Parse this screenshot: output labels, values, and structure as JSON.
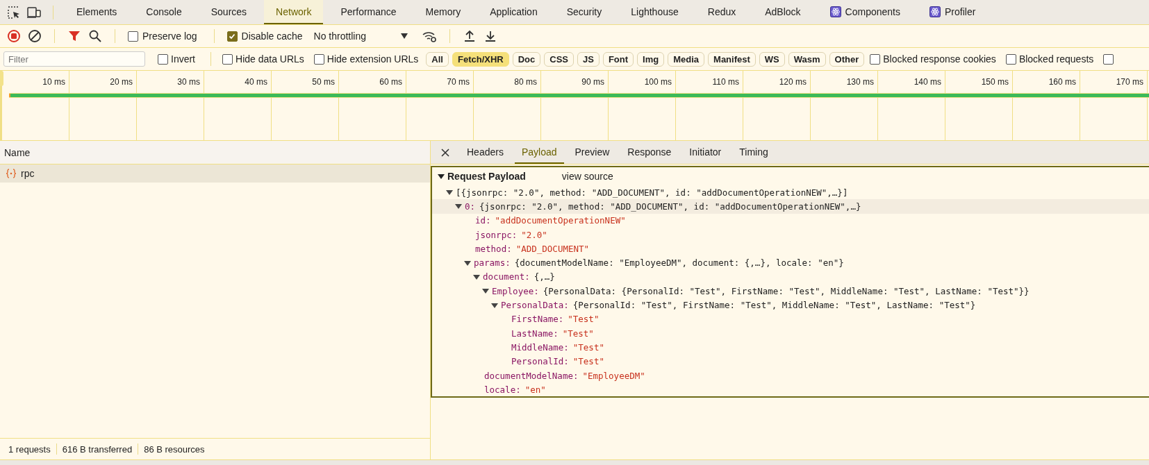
{
  "panel_tabs": [
    {
      "label": "Elements",
      "selected": false,
      "kind": "plain"
    },
    {
      "label": "Console",
      "selected": false,
      "kind": "plain"
    },
    {
      "label": "Sources",
      "selected": false,
      "kind": "plain"
    },
    {
      "label": "Network",
      "selected": true,
      "kind": "plain"
    },
    {
      "label": "Performance",
      "selected": false,
      "kind": "plain"
    },
    {
      "label": "Memory",
      "selected": false,
      "kind": "plain"
    },
    {
      "label": "Application",
      "selected": false,
      "kind": "plain"
    },
    {
      "label": "Security",
      "selected": false,
      "kind": "plain"
    },
    {
      "label": "Lighthouse",
      "selected": false,
      "kind": "plain"
    },
    {
      "label": "Redux",
      "selected": false,
      "kind": "plain"
    },
    {
      "label": "AdBlock",
      "selected": false,
      "kind": "plain"
    },
    {
      "label": "Components",
      "selected": false,
      "kind": "react"
    },
    {
      "label": "Profiler",
      "selected": false,
      "kind": "react"
    }
  ],
  "network_toolbar": {
    "options": [
      {
        "label": "Preserve log",
        "checked": false
      },
      {
        "label": "Disable cache",
        "checked": true
      }
    ],
    "throttling": "No throttling"
  },
  "filter_bar": {
    "filter": {
      "placeholder": "Filter"
    },
    "options_left": [
      {
        "label": "Invert",
        "checked": false
      },
      {
        "label": "Hide data URLs",
        "checked": false
      },
      {
        "label": "Hide extension URLs",
        "checked": false
      }
    ],
    "types": [
      {
        "label": "All",
        "selected": false
      },
      {
        "label": "Fetch/XHR",
        "selected": true
      },
      {
        "label": "Doc",
        "selected": false
      },
      {
        "label": "CSS",
        "selected": false
      },
      {
        "label": "JS",
        "selected": false
      },
      {
        "label": "Font",
        "selected": false
      },
      {
        "label": "Img",
        "selected": false
      },
      {
        "label": "Media",
        "selected": false
      },
      {
        "label": "Manifest",
        "selected": false
      },
      {
        "label": "WS",
        "selected": false
      },
      {
        "label": "Wasm",
        "selected": false
      },
      {
        "label": "Other",
        "selected": false
      }
    ],
    "options_right": [
      {
        "label": "Blocked response cookies",
        "checked": false
      },
      {
        "label": "Blocked requests",
        "checked": false
      },
      {
        "checked": false
      }
    ]
  },
  "timeline": {
    "ticks": [
      "10 ms",
      "20 ms",
      "30 ms",
      "40 ms",
      "50 ms",
      "60 ms",
      "70 ms",
      "80 ms",
      "90 ms",
      "100 ms",
      "110 ms",
      "120 ms",
      "130 ms",
      "140 ms",
      "150 ms",
      "160 ms",
      "170 ms"
    ]
  },
  "requests": {
    "column": "Name",
    "rows": [
      {
        "name": "rpc",
        "selected": true
      }
    ]
  },
  "status_bar": [
    "1 requests",
    "616 B transferred",
    "86 B resources"
  ],
  "details": {
    "tabs": [
      {
        "label": "Headers",
        "selected": false
      },
      {
        "label": "Payload",
        "selected": true
      },
      {
        "label": "Preview",
        "selected": false
      },
      {
        "label": "Response",
        "selected": false
      },
      {
        "label": "Initiator",
        "selected": false
      },
      {
        "label": "Timing",
        "selected": false
      }
    ],
    "payload": {
      "title": "Request Payload",
      "expanded": true,
      "view_source": "view source",
      "tree": [
        {
          "summary": "[{jsonrpc: \"2.0\", method: \"ADD_DOCUMENT\", id: \"addDocumentOperationNEW\",…}]",
          "expanded": true,
          "selected": false,
          "children": [
            {
              "key": "0:",
              "summary": "{jsonrpc: \"2.0\", method: \"ADD_DOCUMENT\", id: \"addDocumentOperationNEW\",…}",
              "expanded": true,
              "selected": true,
              "children": [
                {
                  "key": "id:",
                  "value": "\"addDocumentOperationNEW\"",
                  "selected": false
                },
                {
                  "key": "jsonrpc:",
                  "value": "\"2.0\"",
                  "selected": false
                },
                {
                  "key": "method:",
                  "value": "\"ADD_DOCUMENT\"",
                  "selected": false
                },
                {
                  "key": "params:",
                  "summary": "{documentModelName: \"EmployeeDM\", document: {,…}, locale: \"en\"}",
                  "expanded": true,
                  "selected": false,
                  "children": [
                    {
                      "key": "document:",
                      "summary": "{,…}",
                      "expanded": true,
                      "selected": false,
                      "children": [
                        {
                          "key": "Employee:",
                          "summary": "{PersonalData: {PersonalId: \"Test\", FirstName: \"Test\", MiddleName: \"Test\", LastName: \"Test\"}}",
                          "expanded": true,
                          "selected": false,
                          "children": [
                            {
                              "key": "PersonalData:",
                              "summary": "{PersonalId: \"Test\", FirstName: \"Test\", MiddleName: \"Test\", LastName: \"Test\"}",
                              "expanded": true,
                              "selected": false,
                              "children": [
                                {
                                  "key": "FirstName:",
                                  "value": "\"Test\"",
                                  "selected": false
                                },
                                {
                                  "key": "LastName:",
                                  "value": "\"Test\"",
                                  "selected": false
                                },
                                {
                                  "key": "MiddleName:",
                                  "value": "\"Test\"",
                                  "selected": false
                                },
                                {
                                  "key": "PersonalId:",
                                  "value": "\"Test\"",
                                  "selected": false
                                }
                              ]
                            }
                          ]
                        }
                      ]
                    },
                    {
                      "key": "documentModelName:",
                      "value": "\"EmployeeDM\"",
                      "selected": false
                    },
                    {
                      "key": "locale:",
                      "value": "\"en\"",
                      "selected": false
                    }
                  ]
                }
              ]
            }
          ]
        }
      ]
    }
  }
}
